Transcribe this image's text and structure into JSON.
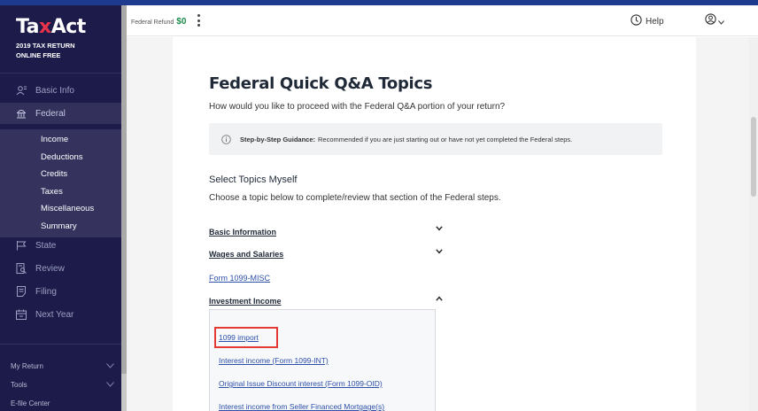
{
  "sidebar": {
    "logo": {
      "tax": "Ta",
      "x": "x",
      "act": "Act"
    },
    "product_line1": "2019 TAX RETURN",
    "product_line2": "ONLINE FREE",
    "nav": [
      {
        "label": "Basic Info",
        "icon": "person-icon"
      },
      {
        "label": "Federal",
        "icon": "capitol-icon",
        "active": true
      },
      {
        "label": "State",
        "icon": "flag-icon"
      },
      {
        "label": "Review",
        "icon": "review-icon"
      },
      {
        "label": "Filing",
        "icon": "filing-icon"
      },
      {
        "label": "Next Year",
        "icon": "calendar-icon"
      }
    ],
    "federal_subnav": [
      "Income",
      "Deductions",
      "Credits",
      "Taxes",
      "Miscellaneous",
      "Summary"
    ],
    "bottom": [
      {
        "label": "My Return",
        "icon": "chevron-down-icon"
      },
      {
        "label": "Tools",
        "icon": "chevron-down-icon"
      },
      {
        "label": "E-file Center"
      }
    ]
  },
  "topbar": {
    "refund_label": "Federal Refund",
    "refund_amount": "$0",
    "help_label": "Help"
  },
  "main": {
    "title": "Federal Quick Q&A Topics",
    "subtitle": "How would you like to proceed with the Federal Q&A portion of your return?",
    "guidance_bold": "Step-by-Step Guidance:",
    "guidance_text": "Recommended if you are just starting out or have not yet completed the Federal steps.",
    "section_title": "Select Topics Myself",
    "section_subtitle": "Choose a topic below to complete/review that section of the Federal steps.",
    "topics": [
      {
        "label": "Basic Information",
        "state": "collapsed"
      },
      {
        "label": "Wages and Salaries",
        "state": "collapsed"
      }
    ],
    "form_link": "Form 1099-MISC",
    "investment_topic": "Investment Income",
    "investment_links": [
      "1099 import",
      "Interest income (Form 1099-INT)",
      "Original Issue Discount interest (Form 1099-OID)",
      "Interest income from Seller Financed Mortgage(s)"
    ]
  },
  "colors": {
    "sidebar_bg": "#1d1b4a",
    "accent_red": "#e8334a",
    "refund_green": "#1a8a4a",
    "link_blue": "#2c4fa8",
    "highlight_red": "#e53935"
  }
}
